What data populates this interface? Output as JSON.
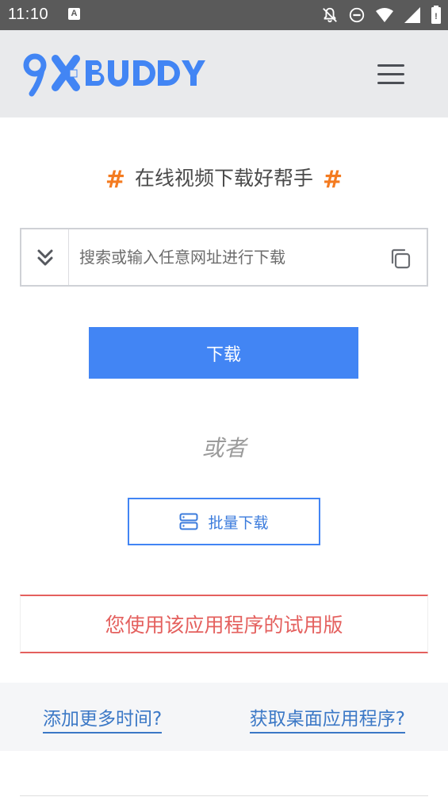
{
  "status_bar": {
    "time": "11:10",
    "keyboard_indicator": "A",
    "icons": [
      "notifications-off-icon",
      "do-not-disturb-icon",
      "wifi-icon",
      "signal-icon",
      "battery-icon"
    ]
  },
  "header": {
    "logo_text": "9XBUDDY",
    "menu_icon": "hamburger-menu-icon"
  },
  "main": {
    "headline_hash_left": "#",
    "headline": "在线视频下载好帮手",
    "headline_hash_right": "#",
    "search": {
      "placeholder": "搜索或输入任意网址进行下载",
      "value": "",
      "dropdown_icon": "double-chevron-down-icon",
      "paste_icon": "copy-icon"
    },
    "download_label": "下载",
    "or_label": "或者",
    "batch_label": "批量下载",
    "batch_icon": "server-icon",
    "trial_notice": "您使用该应用程序的试用版"
  },
  "footer": {
    "add_time_link": "添加更多时间?",
    "desktop_app_link": "获取桌面应用程序?"
  },
  "colors": {
    "accent_orange": "#f47b20",
    "primary_blue": "#4285f4",
    "trial_red": "#e4605e",
    "link_blue": "#3b78c6"
  }
}
